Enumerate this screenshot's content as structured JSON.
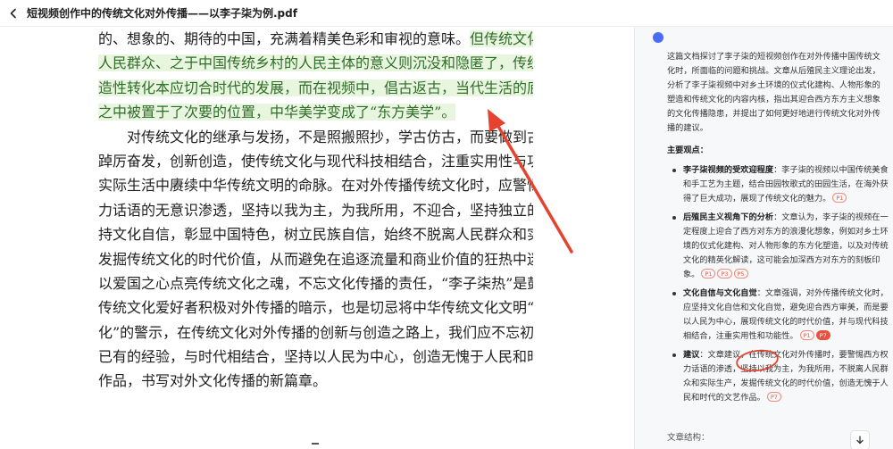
{
  "header": {
    "title": "短视频创作中的传统文化对外传播——以李子柒为例.pdf"
  },
  "document": {
    "lines": [
      {
        "text": "的、想象的、期待的中国，充满着精美色彩和审视的意味。",
        "highlight": "但传统文化之于普通"
      },
      {
        "text": "",
        "highlight": "人民群众、之于中国传统乡村的人民主体的意义则沉没和隐匿了，传统文化的创"
      },
      {
        "text": "",
        "highlight": "造性转化本应切合时代的发展，而在视频中，倡古返古，当代生活的底蕴在无形"
      },
      {
        "text": "",
        "highlight": "之中被置于了次要的位置，中华美学变成了“东方美学”。"
      },
      {
        "text": "对传统文化的继承与发扬，不是照搬照抄，学古仿古，而要做到古为今用，",
        "indent": true
      },
      {
        "text": "踔厉奋发，创新创造，使传统文化与现代科技相结合，注重实用性与功能性，在"
      },
      {
        "text": "实际生活中赓续中华传统文明的命脉。在对外传播传统文化时，应警惕西方的权"
      },
      {
        "text": "力话语的无意识渗透，坚持以我为主，为我所用，不迎合，坚持独立的姿态，保"
      },
      {
        "text": "持文化自信，彰显中国特色，树立民族自信，始终不脱离人民群众和实际生产，"
      },
      {
        "text": "发掘传统文化的时代价值，从而避免在追逐流量和商业价值的狂热中迷失方向，"
      },
      {
        "text": "以爱国之心点亮传统文化之魂，不忘文化传播的责任，“李子柒热”是鼓励民间"
      },
      {
        "text": "传统文化爱好者积极对外传播的暗示，也是切忌将中华传统文化文明“自我东方"
      },
      {
        "text": "化”的警示，在传统文化对外传播的创新与创造之路上，我们应不忘初心，借鉴"
      },
      {
        "text": "已有的经验，与时代相结合，坚持以人民为中心，创造无愧于人民和时代的文艺"
      },
      {
        "text": "作品，书写对外文化传播的新篇章。"
      }
    ]
  },
  "assistant": {
    "summary": "这篇文档探讨了李子柒的短视频创作在对外传播中国传统文化时，所面临的问题和挑战。文章从后殖民主义理论出发，分析了李子柒视频中对乡土环境的仪式化建构、人物形象的塑造和传统文化的内容内核，指出其迎合西方东方主义想象的文化传播隐患，并提出了如何更好地进行传统文化对外传播的建议。",
    "section_title": "主要观点：",
    "points": [
      {
        "title": "李子柒视频的受欢迎程度",
        "body": "：李子柒的视频以中国传统美食和手工艺为主题，结合田园牧歌式的田园生活，在海外获得了巨大成功，展现了传统文化的魅力。",
        "refs": [
          "P1"
        ]
      },
      {
        "title": "后殖民主义视角下的分析",
        "body": "：文章认为，李子柒的视频在一定程度上迎合了西方对东方的浪漫化想象，例如对乡土环境的仪式化建构、对人物形象的东方化塑造，以及对传统文化的精英化解读，这可能会加深西方对东方的刻板印象。",
        "refs": [
          "P1",
          "P3",
          "P5"
        ]
      },
      {
        "title": "文化自信与文化自觉",
        "body": "：文章强调，对外传播传统文化时，应坚持文化自信和文化自觉，避免迎合西方审美，而是要以人民为中心，展现传统文化的时代价值，并与现代科技相结合，注重实用性和功能性。",
        "refs": [
          "P1",
          "P7"
        ]
      },
      {
        "title": "建议",
        "body": "：文章建议，在传统文化对外传播时，要警惕西方权力话语的渗透，坚持以我为主，为我所用，不脱离人民群众和实际生产，发掘传统文化的时代价值，创造无愧于人民和时代的文艺作品。",
        "refs": [
          "P7"
        ]
      }
    ],
    "structure_label": "文章结构："
  },
  "colors": {
    "highlight_bg": "#e8f5df",
    "highlight_text": "#2f6d29",
    "annotation_red": "#e5432f",
    "ref_red": "#e55b47"
  }
}
